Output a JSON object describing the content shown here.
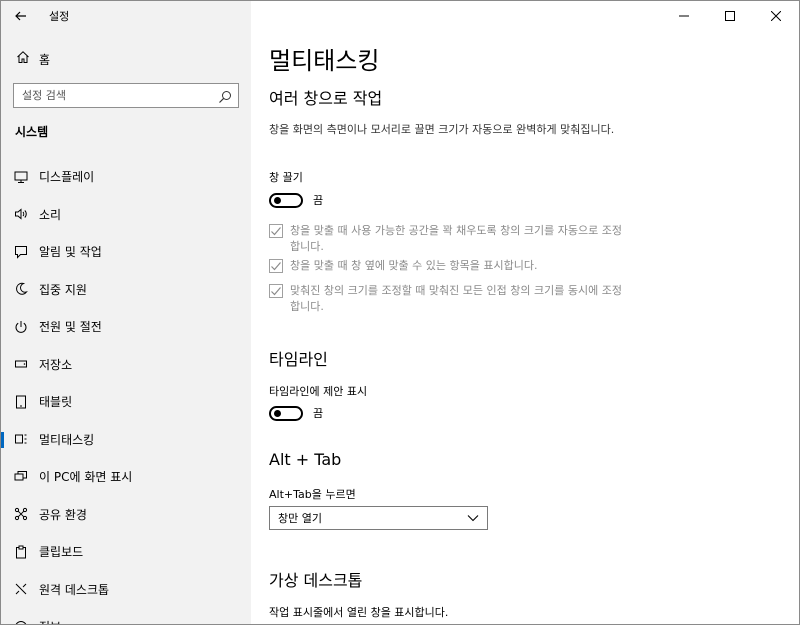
{
  "window": {
    "title": "설정"
  },
  "sidebar": {
    "home_label": "홈",
    "search_placeholder": "설정 검색",
    "section_title": "시스템",
    "items": [
      {
        "label": "디스플레이",
        "icon": "monitor-icon"
      },
      {
        "label": "소리",
        "icon": "speaker-icon"
      },
      {
        "label": "알림 및 작업",
        "icon": "notification-icon"
      },
      {
        "label": "집중 지원",
        "icon": "moon-icon"
      },
      {
        "label": "전원 및 절전",
        "icon": "power-icon"
      },
      {
        "label": "저장소",
        "icon": "storage-icon"
      },
      {
        "label": "태블릿",
        "icon": "tablet-icon"
      },
      {
        "label": "멀티태스킹",
        "icon": "multitasking-icon",
        "active": true
      },
      {
        "label": "이 PC에 화면 표시",
        "icon": "project-icon"
      },
      {
        "label": "공유 환경",
        "icon": "share-icon"
      },
      {
        "label": "클립보드",
        "icon": "clipboard-icon"
      },
      {
        "label": "원격 데스크톱",
        "icon": "remote-desktop-icon"
      },
      {
        "label": "정보",
        "icon": "info-icon"
      }
    ]
  },
  "main": {
    "title": "멀티태스킹",
    "snap": {
      "heading": "여러 창으로 작업",
      "description": "창을 화면의 측면이나 모서리로 끌면 크기가 자동으로 완벽하게 맞춰집니다.",
      "toggle_label": "창 끌기",
      "toggle_state": "끔",
      "options": [
        "창을 맞출 때 사용 가능한 공간을 꽉 채우도록 창의 크기를 자동으로 조정합니다.",
        "창을 맞출 때 창 옆에 맞출 수 있는 항목을 표시합니다.",
        "맞춰진 창의 크기를 조정할 때 맞춰진 모든 인접 창의 크기를 동시에 조정합니다."
      ]
    },
    "timeline": {
      "heading": "타임라인",
      "toggle_label": "타임라인에 제안 표시",
      "toggle_state": "끔"
    },
    "alttab": {
      "heading": "Alt + Tab",
      "select_label": "Alt+Tab을 누르면",
      "select_value": "창만 열기"
    },
    "desktops": {
      "heading": "가상 데스크톱",
      "label": "작업 표시줄에서 열린 창을 표시합니다."
    }
  }
}
